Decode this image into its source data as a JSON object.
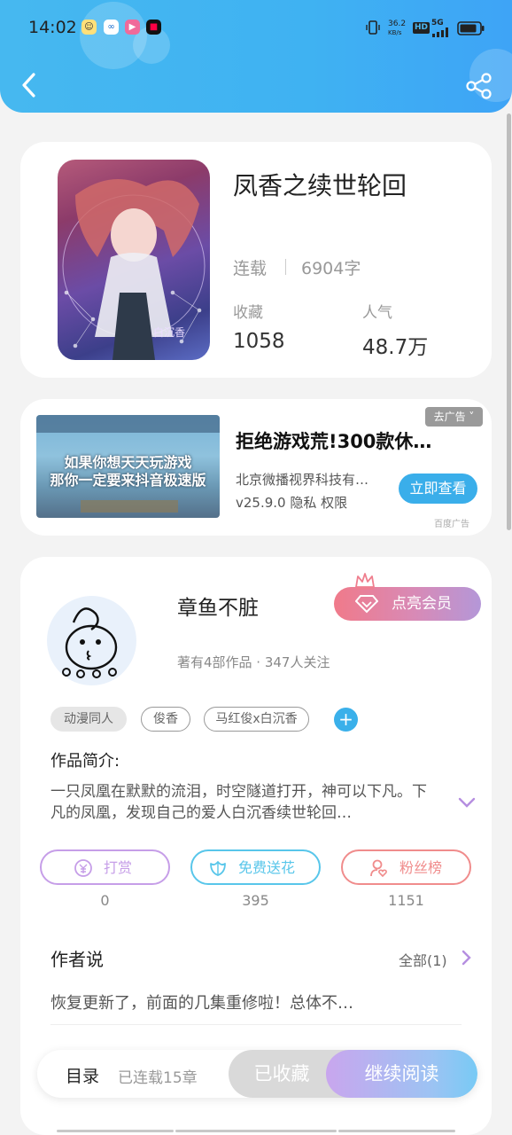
{
  "status_bar": {
    "time": "14:02",
    "net_speed_value": "36.2",
    "net_speed_unit": "KB/s",
    "hd": "HD",
    "network": "5G"
  },
  "header": {
    "back_icon": "chevron-left-icon",
    "share_icon": "share-icon"
  },
  "book": {
    "title": "凤香之续世轮回",
    "status": "连载",
    "word_count": "6904字",
    "favorites_label": "收藏",
    "favorites_value": "1058",
    "popularity_label": "人气",
    "popularity_value": "48.7万",
    "cover_text": "白沉香"
  },
  "ad": {
    "image_text_1": "如果你想天天玩游戏",
    "image_text_2": "那你一定要来抖音极速版",
    "title": "拒绝游戏荒!300款休…",
    "company": "北京微播视界科技有…",
    "meta": "v25.9.0  隐私  权限",
    "tag": "去广告 ˅",
    "button": "立即查看",
    "source": "百度广告"
  },
  "author": {
    "name": "章鱼不脏",
    "meta": "著有4部作品 · 347人关注",
    "vip_button": "点亮会员",
    "tags": [
      "动漫同人",
      "俊香",
      "马红俊x白沉香"
    ],
    "add_tag": "+",
    "intro_label": "作品简介:",
    "intro_text": "一只凤凰在默默的流泪，时空隧道打开，神可以下凡。下凡的凤凰，发现自己的爱人白沉香续世轮回…",
    "actions": [
      {
        "label": "打赏",
        "count": "0",
        "color": "#c69ee8"
      },
      {
        "label": "免费送花",
        "count": "395",
        "color": "#58c6ea"
      },
      {
        "label": "粉丝榜",
        "count": "1151",
        "color": "#f08c8c"
      }
    ],
    "says_label": "作者说",
    "says_all": "全部(1)",
    "says_text": "恢复更新了，前面的几集重修啦！总体不…"
  },
  "bottom_bar": {
    "toc": "目录",
    "chapters": "已连载15章",
    "favorited": "已收藏",
    "continue": "继续阅读"
  }
}
